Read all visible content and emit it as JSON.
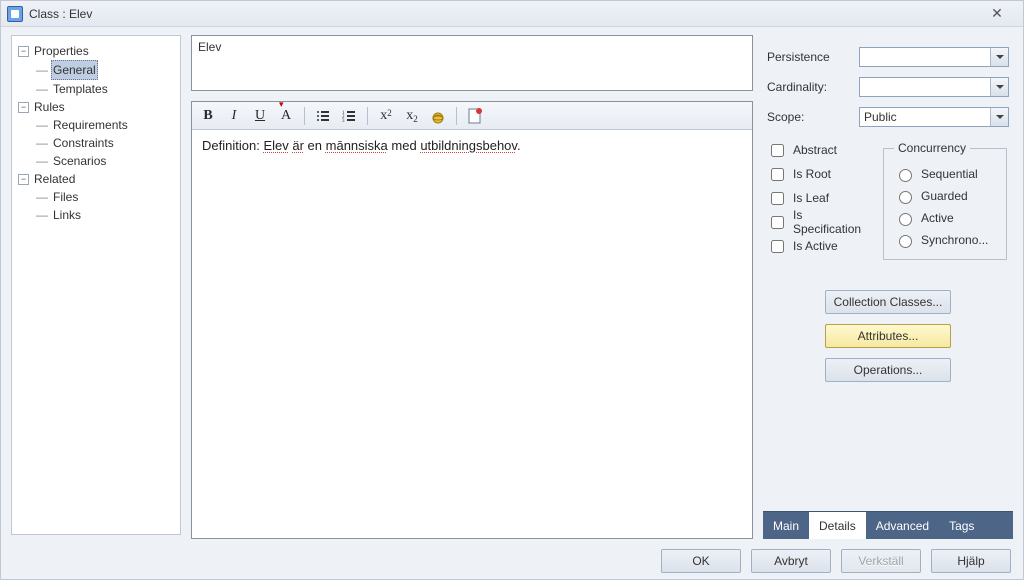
{
  "title": "Class : Elev",
  "tree": {
    "nodes": [
      {
        "label": "Properties",
        "level": 1,
        "expanded": true
      },
      {
        "label": "General",
        "level": 2,
        "selected": true
      },
      {
        "label": "Templates",
        "level": 2
      },
      {
        "label": "Rules",
        "level": 1,
        "expanded": true
      },
      {
        "label": "Requirements",
        "level": 2
      },
      {
        "label": "Constraints",
        "level": 2
      },
      {
        "label": "Scenarios",
        "level": 2
      },
      {
        "label": "Related",
        "level": 1,
        "expanded": true
      },
      {
        "label": "Files",
        "level": 2
      },
      {
        "label": "Links",
        "level": 2
      }
    ]
  },
  "name_value": "Elev",
  "toolbar": {
    "bold": "B",
    "italic": "I",
    "underline": "U"
  },
  "definition": {
    "label": "Definition:",
    "w1": "Elev",
    "w2": "är",
    "w3": "en",
    "w4": "mānnsiska",
    "w5": "med",
    "w6": "utbildningsbehov",
    "period": "."
  },
  "side": {
    "persistence_label": "Persistence",
    "cardinality_label": "Cardinality:",
    "scope_label": "Scope:",
    "scope_value": "Public",
    "abstract": "Abstract",
    "is_root": "Is Root",
    "is_leaf": "Is Leaf",
    "is_spec": "Is Specification",
    "is_active": "Is Active",
    "concurrency": "Concurrency",
    "sequential": "Sequential",
    "guarded": "Guarded",
    "active": "Active",
    "synchrono": "Synchrono...",
    "collection_btn": "Collection Classes...",
    "attributes_btn": "Attributes...",
    "operations_btn": "Operations..."
  },
  "tabs": {
    "main": "Main",
    "details": "Details",
    "advanced": "Advanced",
    "tags": "Tags"
  },
  "buttons": {
    "ok": "OK",
    "cancel": "Avbryt",
    "apply": "Verkställ",
    "help": "Hjälp"
  }
}
